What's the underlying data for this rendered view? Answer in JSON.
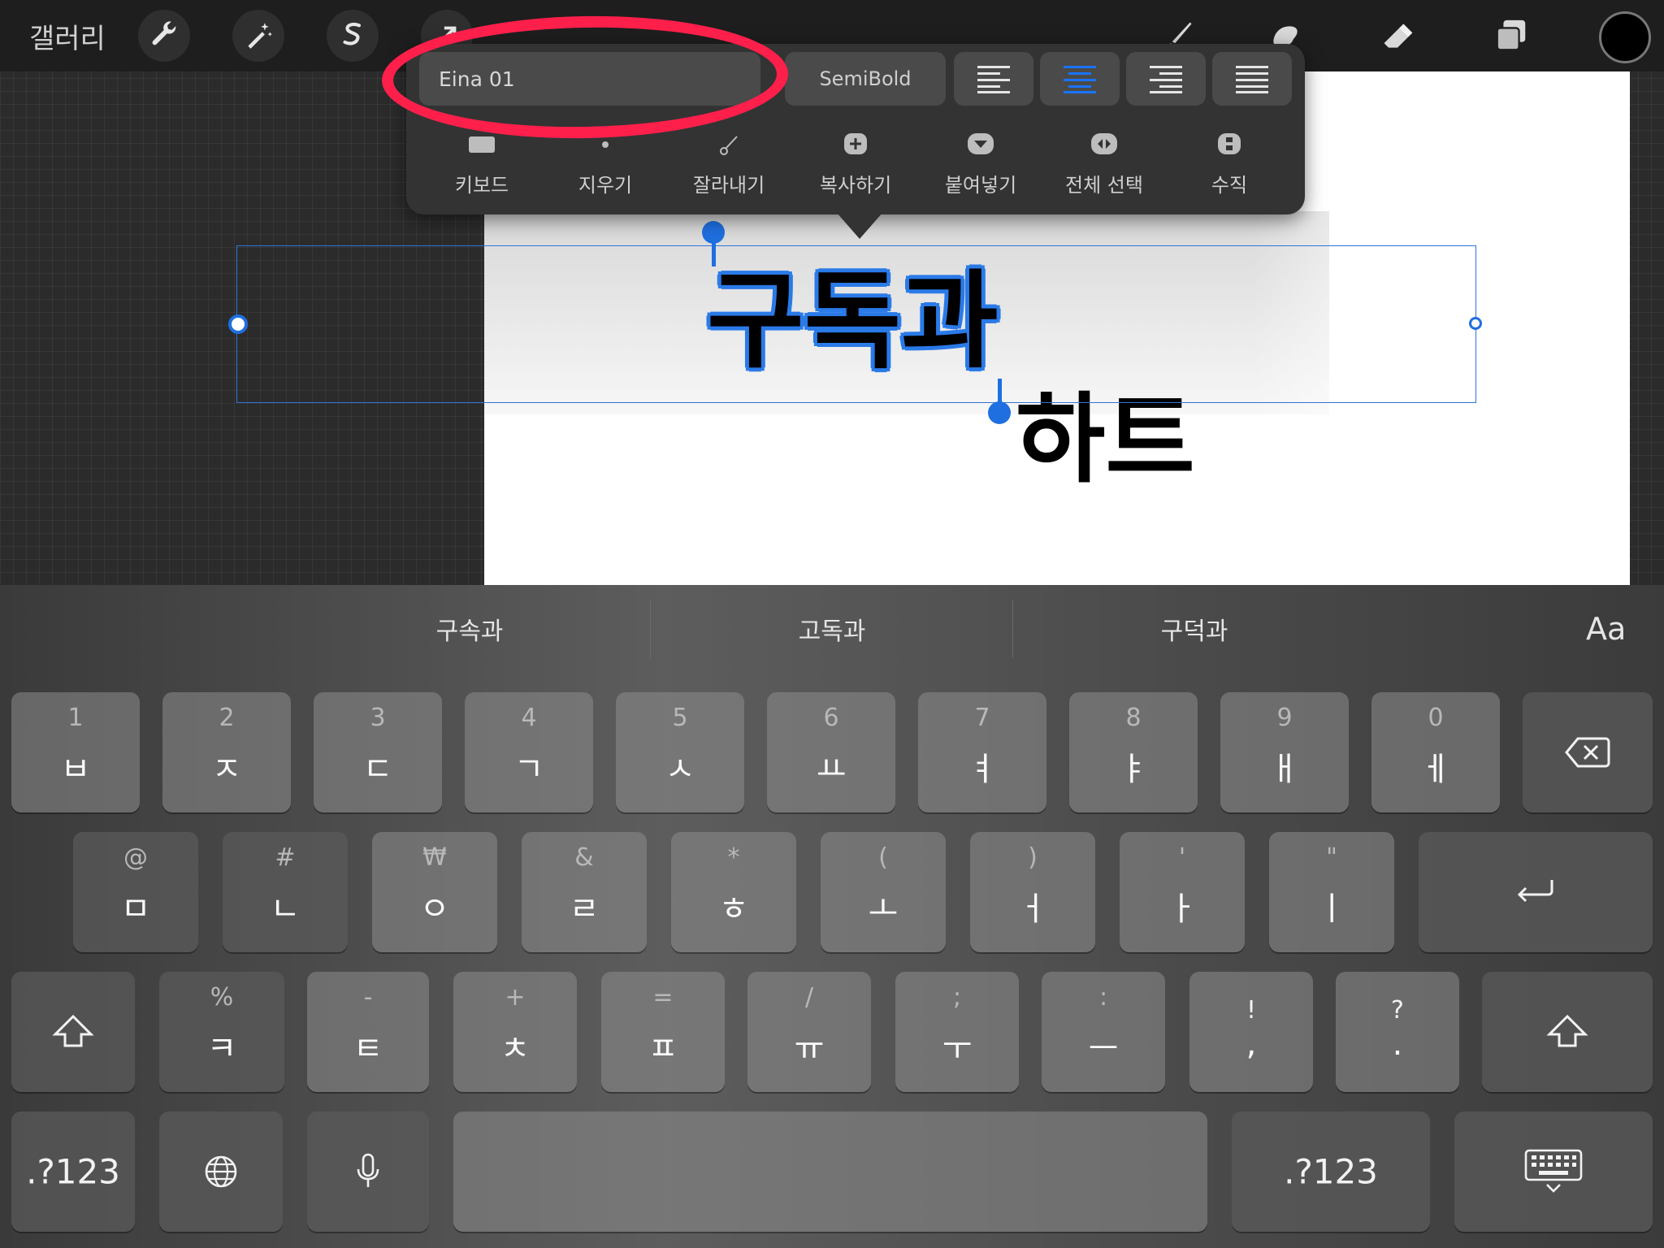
{
  "toolbar": {
    "gallery": "갤러리",
    "left_tools": [
      "wrench-icon",
      "magic-wand-icon",
      "selection-s-icon"
    ],
    "right_tools": [
      "brush-icon",
      "smudge-icon",
      "eraser-icon",
      "layers-icon"
    ],
    "color": "#000000"
  },
  "text_popover": {
    "font": "Eina 01",
    "weight": "SemiBold",
    "alignment_selected": "center",
    "actions": [
      "키보드",
      "지우기",
      "잘라내기",
      "복사하기",
      "붙여넣기",
      "전체 선택",
      "수직"
    ]
  },
  "canvas": {
    "selected_text": "구독과",
    "line2": "하트"
  },
  "keyboard": {
    "suggestions": [
      "구속과",
      "고독과",
      "구덕과"
    ],
    "aa": "Aa",
    "row1": [
      {
        "num": "1",
        "ch": "ㅂ"
      },
      {
        "num": "2",
        "ch": "ㅈ"
      },
      {
        "num": "3",
        "ch": "ㄷ"
      },
      {
        "num": "4",
        "ch": "ㄱ"
      },
      {
        "num": "5",
        "ch": "ㅅ"
      },
      {
        "num": "6",
        "ch": "ㅛ"
      },
      {
        "num": "7",
        "ch": "ㅕ"
      },
      {
        "num": "8",
        "ch": "ㅑ"
      },
      {
        "num": "9",
        "ch": "ㅐ"
      },
      {
        "num": "0",
        "ch": "ㅔ"
      }
    ],
    "row2": [
      {
        "num": "@",
        "ch": "ㅁ"
      },
      {
        "num": "#",
        "ch": "ㄴ"
      },
      {
        "num": "₩",
        "ch": "ㅇ"
      },
      {
        "num": "&",
        "ch": "ㄹ"
      },
      {
        "num": "*",
        "ch": "ㅎ"
      },
      {
        "num": "(",
        "ch": "ㅗ"
      },
      {
        "num": ")",
        "ch": "ㅓ"
      },
      {
        "num": "'",
        "ch": "ㅏ"
      },
      {
        "num": "\"",
        "ch": "ㅣ"
      }
    ],
    "row3": [
      {
        "num": "%",
        "ch": "ㅋ"
      },
      {
        "num": "-",
        "ch": "ㅌ"
      },
      {
        "num": "+",
        "ch": "ㅊ"
      },
      {
        "num": "=",
        "ch": "ㅍ"
      },
      {
        "num": "/",
        "ch": "ㅠ"
      },
      {
        "num": ";",
        "ch": "ㅜ"
      },
      {
        "num": ":",
        "ch": "ㅡ"
      },
      {
        "num": "!",
        "ch": ","
      },
      {
        "num": "?",
        "ch": "."
      }
    ],
    "num_label": ".?123"
  }
}
